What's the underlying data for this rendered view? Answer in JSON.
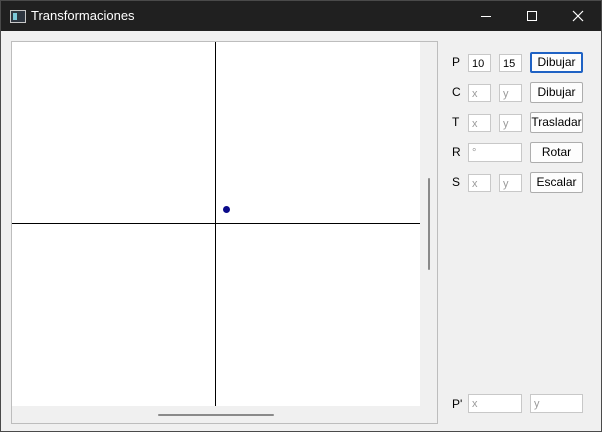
{
  "window": {
    "title": "Transformaciones"
  },
  "rows": {
    "p": {
      "label": "P",
      "x": "10",
      "y": "15",
      "button": "Dibujar"
    },
    "c": {
      "label": "C",
      "x_placeholder": "x",
      "y_placeholder": "y",
      "button": "Dibujar"
    },
    "t": {
      "label": "T",
      "x_placeholder": "x",
      "y_placeholder": "y",
      "button": "Trasladar"
    },
    "r": {
      "label": "R",
      "angle_placeholder": "°",
      "button": "Rotar"
    },
    "s": {
      "label": "S",
      "x_placeholder": "x",
      "y_placeholder": "y",
      "button": "Escalar"
    },
    "result": {
      "label": "P'",
      "x_placeholder": "x",
      "y_placeholder": "y"
    }
  },
  "colors": {
    "point": "#0a0a8a",
    "focus_border": "#1f62c4",
    "titlebar": "#202020"
  }
}
